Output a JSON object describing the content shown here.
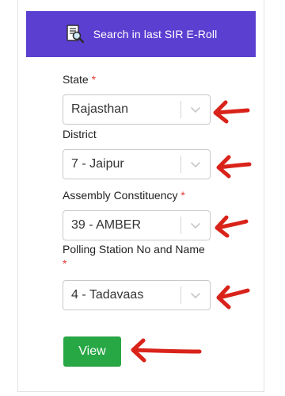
{
  "header": {
    "title": "Search in last SIR E-Roll",
    "icon": "search-document-icon",
    "background_color": "#5b3fd1"
  },
  "form": {
    "fields": [
      {
        "label": "State",
        "required_mark": "*",
        "value": "Rajasthan"
      },
      {
        "label": "District",
        "required_mark": "",
        "value": "7 - Jaipur"
      },
      {
        "label": "Assembly Constituency",
        "required_mark": "*",
        "value": "39 - AMBER"
      },
      {
        "label": "Polling Station No and Name",
        "required_mark": "*",
        "value": "4 - Tadavaas"
      }
    ]
  },
  "actions": {
    "view_label": "View",
    "view_color": "#28a745"
  },
  "annotations": {
    "arrow_color": "#d9231a",
    "arrow_icon": "red-arrow-pointing-left-icon"
  }
}
